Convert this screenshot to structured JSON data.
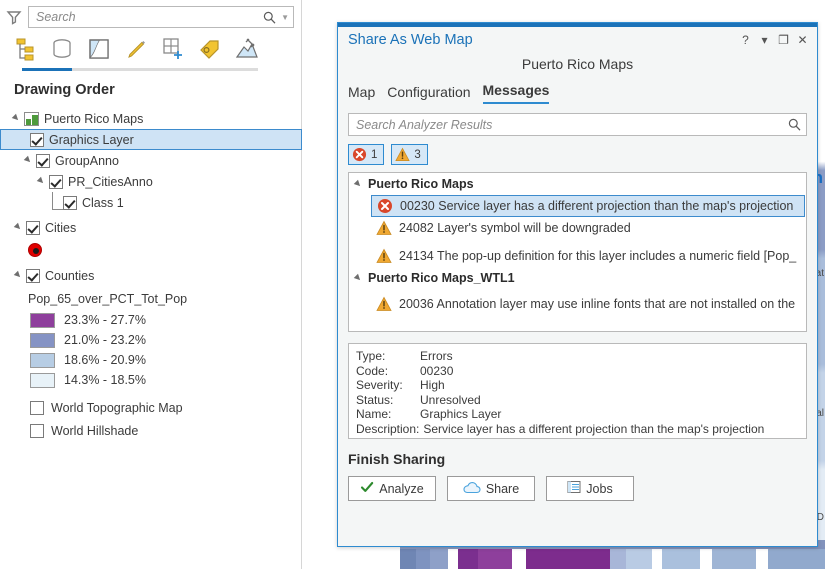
{
  "toc": {
    "search": {
      "placeholder": "Search",
      "value": ""
    },
    "filter_icon": "funnel-icon",
    "search_icon": "search-icon",
    "toolbar": [
      {
        "name": "list-by-drawing-order-icon",
        "active": true
      },
      {
        "name": "list-by-data-source-icon",
        "active": false
      },
      {
        "name": "list-by-selection-icon",
        "active": false
      },
      {
        "name": "list-by-editing-icon",
        "active": false
      },
      {
        "name": "list-by-snapping-icon",
        "active": false
      },
      {
        "name": "list-by-labeling-icon",
        "active": false
      },
      {
        "name": "list-by-charts-icon",
        "active": false
      }
    ],
    "heading": "Drawing Order",
    "tree": [
      {
        "label": "Puerto Rico Maps",
        "indent": 0,
        "type": "map",
        "expanded": true
      },
      {
        "label": "Graphics Layer",
        "indent": 1,
        "type": "layer",
        "checked": true,
        "selected": true
      },
      {
        "label": "GroupAnno",
        "indent": 1,
        "type": "group",
        "checked": true,
        "expanded": true
      },
      {
        "label": "PR_CitiesAnno",
        "indent": 2,
        "type": "group",
        "checked": true,
        "expanded": true
      },
      {
        "label": "Class 1",
        "indent": 3,
        "type": "layer",
        "checked": true
      },
      {
        "label": "Cities",
        "indent": 1,
        "type": "group",
        "checked": true,
        "expanded": true
      },
      {
        "label": "Counties",
        "indent": 1,
        "type": "group",
        "checked": true,
        "expanded": true
      }
    ],
    "legend": {
      "field": "Pop_65_over_PCT_Tot_Pop",
      "classes": [
        {
          "label": "23.3% - 27.7%",
          "color": "#8e3f9c"
        },
        {
          "label": "21.0% - 23.2%",
          "color": "#8593c4"
        },
        {
          "label": "18.6% - 20.9%",
          "color": "#b7cde4"
        },
        {
          "label": "14.3% - 18.5%",
          "color": "#e8f2f8"
        }
      ]
    },
    "basemaps": [
      {
        "label": "World Topographic Map",
        "checked": false
      },
      {
        "label": "World Hillshade",
        "checked": false
      }
    ]
  },
  "dialog": {
    "title": "Share As Web Map",
    "subtitle": "Puerto Rico Maps",
    "window_buttons": [
      {
        "name": "help-button",
        "glyph": "?"
      },
      {
        "name": "menu-dropdown-button",
        "glyph": "▾"
      },
      {
        "name": "maximize-button",
        "glyph": "❐"
      },
      {
        "name": "close-button",
        "glyph": "✕"
      }
    ],
    "tabs": [
      {
        "label": "Map",
        "active": false
      },
      {
        "label": "Configuration",
        "active": false
      },
      {
        "label": "Messages",
        "active": true
      }
    ],
    "analyzer_search": {
      "placeholder": "Search Analyzer Results",
      "value": ""
    },
    "badges": [
      {
        "name": "error-filter-badge",
        "icon": "error-icon",
        "count": "1"
      },
      {
        "name": "warning-filter-badge",
        "icon": "warning-icon",
        "count": "3"
      }
    ],
    "messages": [
      {
        "group": "Puerto Rico Maps",
        "items": [
          {
            "severity": "error",
            "code": "00230",
            "text": "00230 Service layer has a different projection than the map's projection",
            "selected": true
          },
          {
            "severity": "warning",
            "code": "24082",
            "text": "24082 Layer's symbol will be downgraded",
            "selected": false
          },
          {
            "severity": "warning",
            "code": "24134",
            "text": "24134 The pop-up definition for this layer includes a numeric field [Pop_",
            "selected": false
          }
        ]
      },
      {
        "group": "Puerto Rico Maps_WTL1",
        "items": [
          {
            "severity": "warning",
            "code": "20036",
            "text": "20036 Annotation layer may use inline fonts that are not installed on the",
            "selected": false
          }
        ]
      }
    ],
    "details": {
      "type_key": "Type:",
      "type_val": "Errors",
      "code_key": "Code:",
      "code_val": "00230",
      "severity_key": "Severity:",
      "severity_val": "High",
      "status_key": "Status:",
      "status_val": "Unresolved",
      "name_key": "Name:",
      "name_val": "Graphics Layer",
      "description_key": "Description:",
      "description_val": "Service layer has a different projection than the map's projection"
    },
    "finish_label": "Finish Sharing",
    "buttons": [
      {
        "label": "Analyze",
        "icon": "check-icon"
      },
      {
        "label": "Share",
        "icon": "cloud-icon"
      },
      {
        "label": "Jobs",
        "icon": "list-icon"
      }
    ]
  },
  "map_background": {
    "word": "n",
    "labels": [
      "nat",
      "lal",
      "i D"
    ]
  }
}
